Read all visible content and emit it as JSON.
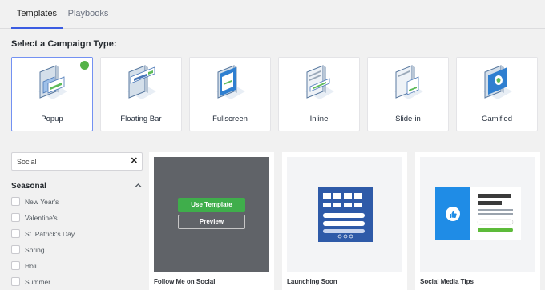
{
  "tabs": [
    {
      "label": "Templates",
      "active": true
    },
    {
      "label": "Playbooks",
      "active": false
    }
  ],
  "section_title": "Select a Campaign Type:",
  "campaign_types": [
    {
      "label": "Popup",
      "icon": "popup-icon",
      "selected": true
    },
    {
      "label": "Floating Bar",
      "icon": "floating-bar-icon",
      "selected": false
    },
    {
      "label": "Fullscreen",
      "icon": "fullscreen-icon",
      "selected": false
    },
    {
      "label": "Inline",
      "icon": "inline-icon",
      "selected": false
    },
    {
      "label": "Slide-in",
      "icon": "slide-in-icon",
      "selected": false
    },
    {
      "label": "Gamified",
      "icon": "gamified-icon",
      "selected": false
    }
  ],
  "search": {
    "value": "Social",
    "clear_icon": "close-icon"
  },
  "filters": {
    "heading": "Seasonal",
    "items": [
      "New Year's",
      "Valentine's",
      "St. Patrick's Day",
      "Spring",
      "Holi",
      "Summer"
    ]
  },
  "templates": [
    {
      "name": "Follow Me on Social",
      "use_label": "Use Template",
      "preview_label": "Preview"
    },
    {
      "name": "Launching Soon"
    },
    {
      "name": "Social Media Tips"
    }
  ],
  "colors": {
    "accent": "#3b5ce2",
    "success": "#3fae4b",
    "brand_blue": "#1f8ce6"
  }
}
